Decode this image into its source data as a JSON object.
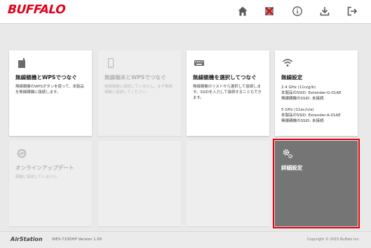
{
  "header": {
    "logo": "BUFFALO",
    "icons": [
      "home-icon",
      "wifi-off-icon",
      "info-icon",
      "download-icon",
      "logout-icon"
    ]
  },
  "tiles": {
    "wps": {
      "title": "無線親機とWPSでつなぐ",
      "desc": "無線親機のWPSボタンを使って、本製品を無線親機に接続します。"
    },
    "device_wps": {
      "title": "無線端末とWPSでつなぐ",
      "desc": "無線親機に接続していません。まず無線親機に接続してください。"
    },
    "select": {
      "title": "無線親機を選択してつなぐ",
      "desc": "無線親機のリストから選択して接続します。SSIDを入力して接続することもできます。"
    },
    "wireless": {
      "title": "無線設定",
      "band1": "2.4 GHz (11n/g/b)",
      "ssid1": "本製品のSSID: Extender-G-01AE",
      "status1": "無線親機のSSID: 未接続",
      "band2": "5 GHz (11ac/n/a)",
      "ssid2": "本製品のSSID: Extender-A-01AE",
      "status2": "無線親機のSSID: 未接続"
    },
    "update": {
      "title": "オンラインアップデート",
      "desc": "親機に接続していません。"
    },
    "advanced": {
      "title": "詳細設定"
    }
  },
  "footer": {
    "brand": "AirStation",
    "model": "WEX-733DHP Version 1.00",
    "copyright": "Copyright © 2015 Buffalo Inc."
  },
  "colors": {
    "brand_red": "#e3001b",
    "highlight_red": "#e0000d",
    "dark_tile": "#757575"
  }
}
